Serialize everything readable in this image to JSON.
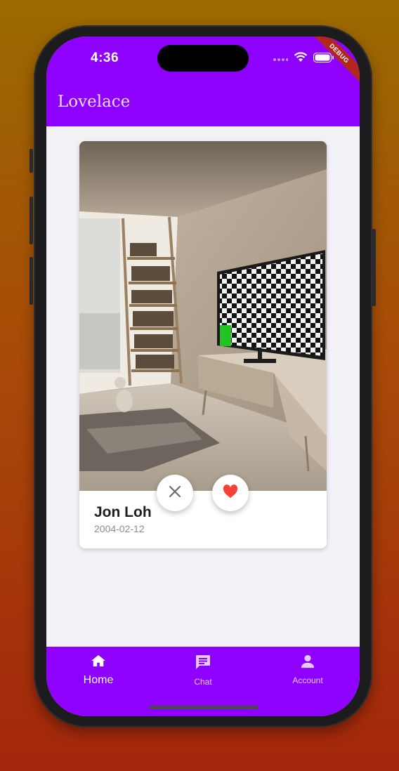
{
  "status_bar": {
    "time": "4:36",
    "debug_label": "DEBUG",
    "icons": [
      "signal-dots-icon",
      "wifi-icon",
      "battery-icon"
    ]
  },
  "app_bar": {
    "title": "Lovelace"
  },
  "profile_card": {
    "name": "Jon Loh",
    "birthdate": "2004-02-12",
    "photo": "living room with bookshelf ladder, cat and TV showing checkerboard",
    "actions": {
      "dislike_icon": "close-icon",
      "like_icon": "heart-icon"
    }
  },
  "bottom_nav": {
    "items": [
      {
        "label": "Home",
        "icon": "home-icon",
        "active": true
      },
      {
        "label": "Chat",
        "icon": "chat-icon",
        "active": false
      },
      {
        "label": "Account",
        "icon": "person-icon",
        "active": false
      }
    ]
  },
  "colors": {
    "primary": "#8e00ff",
    "background": "#f1f1f6",
    "like": "#f44336",
    "debug": "#b3261e"
  }
}
